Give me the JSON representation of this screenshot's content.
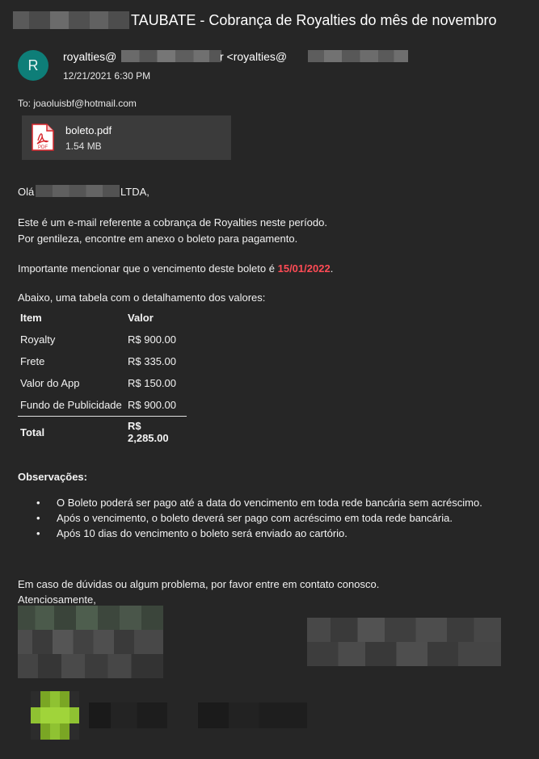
{
  "email": {
    "subject": "TAUBATE - Cobrança de Royalties do mês de novembro",
    "avatar_initial": "R",
    "sender_prefix": "royalties@",
    "sender_mid": "r <royalties@",
    "date": "12/21/2021 6:30 PM",
    "to": "To: joaoluisbf@hotmail.com"
  },
  "attachment": {
    "name": "boleto.pdf",
    "size": "1.54 MB",
    "icon": "pdf-icon",
    "icon_label": "PDF"
  },
  "body": {
    "greeting_prefix": "Olá",
    "greeting_suffix": "LTDA,",
    "intro_line1": "Este é um e-mail referente a cobrança de Royalties neste período.",
    "intro_line2": "Por gentileza, encontre em anexo o boleto para pagamento.",
    "due_prefix": "Importante mencionar que o vencimento deste boleto é",
    "due_date": "15/01/2022",
    "due_suffix": ".",
    "table_intro": "Abaixo, uma tabela com o detalhamento dos valores:",
    "table": {
      "headers": [
        "Item",
        "Valor"
      ],
      "rows": [
        [
          "Royalty",
          "R$ 900.00"
        ],
        [
          "Frete",
          "R$ 335.00"
        ],
        [
          "Valor do App",
          "R$ 150.00"
        ],
        [
          "Fundo de Publicidade",
          "R$ 900.00"
        ]
      ],
      "total_label": "Total",
      "total_value": "R$ 2,285.00"
    },
    "obs_title": "Observações:",
    "obs_items": [
      "O Boleto poderá ser pago até a data do vencimento em toda rede bancária sem acréscimo.",
      "Após o vencimento, o boleto deverá ser pago com acréscimo em toda rede bancária.",
      "Após 10 dias do vencimento o boleto será enviado ao cartório."
    ],
    "closing_line1": "Em caso de dúvidas ou algum problema, por favor entre em contato conosco.",
    "closing_line2": "Atenciosamente,"
  },
  "colors": {
    "background": "#262626",
    "avatar": "#0e7e78",
    "due_date": "#ff4b55",
    "attachment_bg": "#3b3b3b"
  }
}
